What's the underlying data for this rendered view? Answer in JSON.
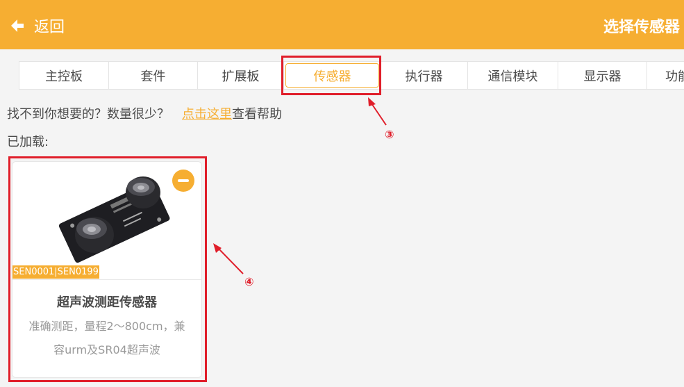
{
  "header": {
    "back_label": "返回",
    "title": "选择传感器",
    "accent_color": "#f6ae32"
  },
  "tabs": [
    {
      "label": "主控板",
      "active": false
    },
    {
      "label": "套件",
      "active": false
    },
    {
      "label": "扩展板",
      "active": false
    },
    {
      "label": "传感器",
      "active": true
    },
    {
      "label": "执行器",
      "active": false
    },
    {
      "label": "通信模块",
      "active": false
    },
    {
      "label": "显示器",
      "active": false
    },
    {
      "label": "功能",
      "active": false
    }
  ],
  "hint": {
    "prefix": "找不到你想要的？数量很少？",
    "link": "点击这里",
    "suffix": "查看帮助"
  },
  "loaded_label": "已加载:",
  "card": {
    "sku": "SEN0001|SEN0199",
    "name": "超声波测距传感器",
    "desc_line1": "准确测距，量程2～800cm，兼",
    "desc_line2": "容urm及SR04超声波",
    "remove_icon": "minus-circle-icon"
  },
  "annotations": {
    "marker_3": "③",
    "marker_4": "④",
    "color": "#e01e2a"
  }
}
